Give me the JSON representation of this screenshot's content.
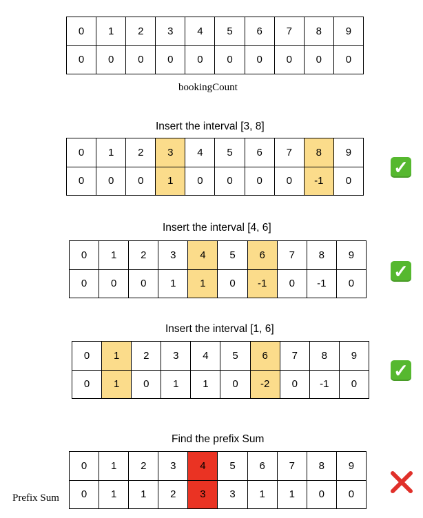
{
  "colors": {
    "highlight_yellow": "#fbdc8b",
    "highlight_red": "#ea3323",
    "check_green": "#56b82f",
    "cross_red": "#e0302a"
  },
  "panels": [
    {
      "caption": "",
      "indices": [
        "0",
        "1",
        "2",
        "3",
        "4",
        "5",
        "6",
        "7",
        "8",
        "9"
      ],
      "values": [
        "0",
        "0",
        "0",
        "0",
        "0",
        "0",
        "0",
        "0",
        "0",
        "0"
      ],
      "highlighted_columns": [],
      "status": "none"
    },
    {
      "caption": "Insert the interval [3, 8]",
      "indices": [
        "0",
        "1",
        "2",
        "3",
        "4",
        "5",
        "6",
        "7",
        "8",
        "9"
      ],
      "values": [
        "0",
        "0",
        "0",
        "1",
        "0",
        "0",
        "0",
        "0",
        "-1",
        "0"
      ],
      "highlighted_columns": [
        3,
        8
      ],
      "status": "check-icon"
    },
    {
      "caption": "Insert the interval [4, 6]",
      "indices": [
        "0",
        "1",
        "2",
        "3",
        "4",
        "5",
        "6",
        "7",
        "8",
        "9"
      ],
      "values": [
        "0",
        "0",
        "0",
        "1",
        "1",
        "0",
        "-1",
        "0",
        "-1",
        "0"
      ],
      "highlighted_columns": [
        4,
        6
      ],
      "status": "check-icon"
    },
    {
      "caption": "Insert the interval [1, 6]",
      "indices": [
        "0",
        "1",
        "2",
        "3",
        "4",
        "5",
        "6",
        "7",
        "8",
        "9"
      ],
      "values": [
        "0",
        "1",
        "0",
        "1",
        "1",
        "0",
        "-2",
        "0",
        "-1",
        "0"
      ],
      "highlighted_columns": [
        1,
        6
      ],
      "status": "check-icon"
    },
    {
      "caption": "Find the prefix Sum",
      "indices": [
        "0",
        "1",
        "2",
        "3",
        "4",
        "5",
        "6",
        "7",
        "8",
        "9"
      ],
      "values": [
        "0",
        "1",
        "1",
        "2",
        "3",
        "3",
        "1",
        "1",
        "0",
        "0"
      ],
      "highlighted_columns": [
        4
      ],
      "status": "cross-icon"
    }
  ],
  "labels": {
    "booking_count": "bookingCount",
    "prefix_sum": "Prefix Sum"
  }
}
